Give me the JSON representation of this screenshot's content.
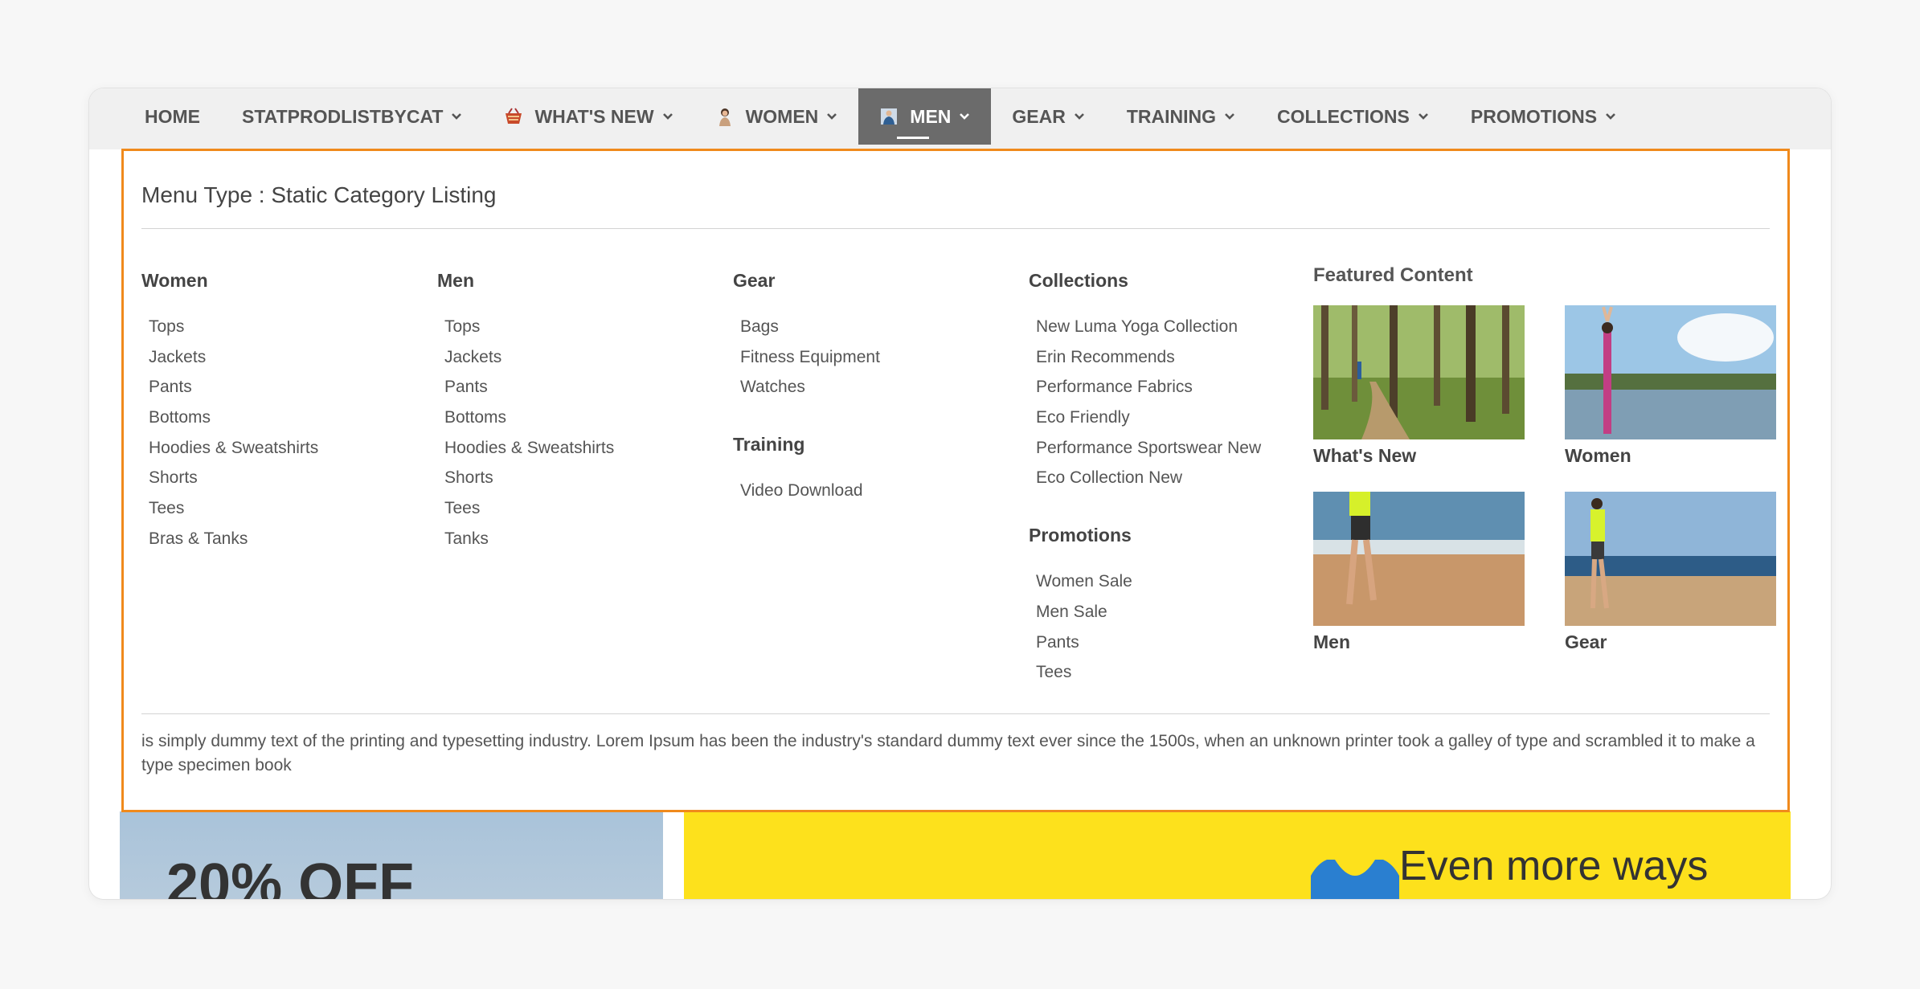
{
  "nav": {
    "items": [
      {
        "label": "HOME",
        "chevron": false,
        "icon": null,
        "active": false
      },
      {
        "label": "STATPRODLISTBYCAT",
        "chevron": true,
        "icon": null,
        "active": false
      },
      {
        "label": "WHAT'S NEW",
        "chevron": true,
        "icon": "basket-icon",
        "active": false
      },
      {
        "label": "WOMEN",
        "chevron": true,
        "icon": "woman-icon",
        "active": false
      },
      {
        "label": "MEN",
        "chevron": true,
        "icon": "man-icon",
        "active": true
      },
      {
        "label": "GEAR",
        "chevron": true,
        "icon": null,
        "active": false
      },
      {
        "label": "TRAINING",
        "chevron": true,
        "icon": null,
        "active": false
      },
      {
        "label": "COLLECTIONS",
        "chevron": true,
        "icon": null,
        "active": false
      },
      {
        "label": "PROMOTIONS",
        "chevron": true,
        "icon": null,
        "active": false
      }
    ]
  },
  "mega": {
    "title": "Menu Type : Static Category Listing",
    "columns": [
      {
        "heading": "Women",
        "items": [
          "Tops",
          "Jackets",
          "Pants",
          "Bottoms",
          "Hoodies & Sweatshirts",
          "Shorts",
          "Tees",
          "Bras & Tanks"
        ]
      },
      {
        "heading": "Men",
        "items": [
          "Tops",
          "Jackets",
          "Pants",
          "Bottoms",
          "Hoodies & Sweatshirts",
          "Shorts",
          "Tees",
          "Tanks"
        ]
      },
      {
        "heading": "Gear",
        "items": [
          "Bags",
          "Fitness Equipment",
          "Watches"
        ]
      },
      {
        "heading": "Collections",
        "items": [
          "New Luma Yoga Collection",
          "Erin Recommends",
          "Performance Fabrics",
          "Eco Friendly",
          "Performance Sportswear New",
          "Eco Collection New"
        ]
      }
    ],
    "training": {
      "heading": "Training",
      "items": [
        "Video Download"
      ]
    },
    "promotions": {
      "heading": "Promotions",
      "items": [
        "Women Sale",
        "Men Sale",
        "Pants",
        "Tees"
      ]
    },
    "featured": {
      "heading": "Featured Content",
      "tiles": [
        {
          "caption": "What's New"
        },
        {
          "caption": "Women"
        },
        {
          "caption": "Men"
        },
        {
          "caption": "Gear"
        }
      ]
    },
    "footer_text": "is simply dummy text of the printing and typesetting industry. Lorem Ipsum has been the industry's standard dummy text ever since the 1500s, when an unknown printer took a galley of type and scrambled it to make a type specimen book"
  },
  "banners": {
    "left_text": "20% OFF",
    "right_text": "Even more ways"
  },
  "colors": {
    "accent_border": "#f08a1c",
    "active_tab": "#6b6b6b",
    "banner_yellow": "#fde11c"
  }
}
